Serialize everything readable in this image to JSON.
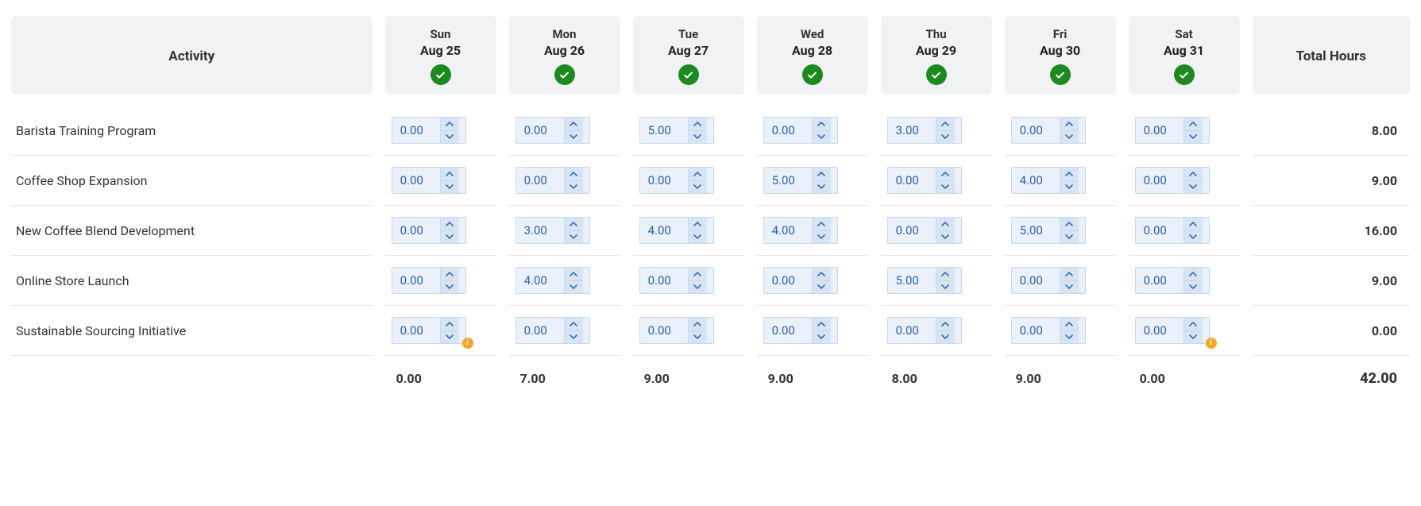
{
  "headers": {
    "activity": "Activity",
    "total": "Total Hours"
  },
  "days": [
    {
      "dow": "Sun",
      "date": "Aug 25",
      "approved": true
    },
    {
      "dow": "Mon",
      "date": "Aug 26",
      "approved": true
    },
    {
      "dow": "Tue",
      "date": "Aug 27",
      "approved": true
    },
    {
      "dow": "Wed",
      "date": "Aug 28",
      "approved": true
    },
    {
      "dow": "Thu",
      "date": "Aug 29",
      "approved": true
    },
    {
      "dow": "Fri",
      "date": "Aug 30",
      "approved": true
    },
    {
      "dow": "Sat",
      "date": "Aug 31",
      "approved": true
    }
  ],
  "rows": [
    {
      "activity": "Barista Training Program",
      "hours": [
        "0.00",
        "0.00",
        "5.00",
        "0.00",
        "3.00",
        "0.00",
        "0.00"
      ],
      "info": [
        false,
        false,
        false,
        false,
        false,
        false,
        false
      ],
      "total": "8.00"
    },
    {
      "activity": "Coffee Shop Expansion",
      "hours": [
        "0.00",
        "0.00",
        "0.00",
        "5.00",
        "0.00",
        "4.00",
        "0.00"
      ],
      "info": [
        false,
        false,
        false,
        false,
        false,
        false,
        false
      ],
      "total": "9.00"
    },
    {
      "activity": "New Coffee Blend Development",
      "hours": [
        "0.00",
        "3.00",
        "4.00",
        "4.00",
        "0.00",
        "5.00",
        "0.00"
      ],
      "info": [
        false,
        false,
        false,
        false,
        false,
        false,
        false
      ],
      "total": "16.00"
    },
    {
      "activity": "Online Store Launch",
      "hours": [
        "0.00",
        "4.00",
        "0.00",
        "0.00",
        "5.00",
        "0.00",
        "0.00"
      ],
      "info": [
        false,
        false,
        false,
        false,
        false,
        false,
        false
      ],
      "total": "9.00"
    },
    {
      "activity": "Sustainable Sourcing Initiative",
      "hours": [
        "0.00",
        "0.00",
        "0.00",
        "0.00",
        "0.00",
        "0.00",
        "0.00"
      ],
      "info": [
        true,
        false,
        false,
        false,
        false,
        false,
        true
      ],
      "total": "0.00"
    }
  ],
  "dayTotals": [
    "0.00",
    "7.00",
    "9.00",
    "9.00",
    "8.00",
    "9.00",
    "0.00"
  ],
  "grandTotal": "42.00"
}
